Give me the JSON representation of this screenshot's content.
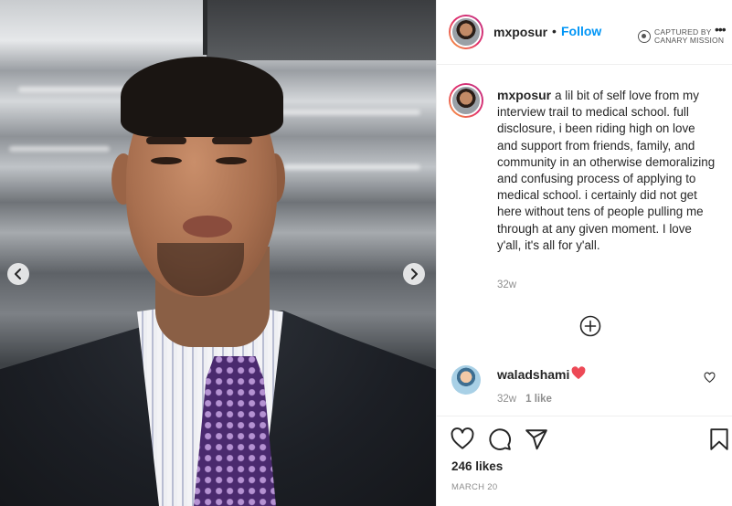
{
  "post": {
    "username": "mxposur",
    "separator": "•",
    "follow_label": "Follow",
    "watermark": {
      "line1": "CAPTURED BY",
      "line2": "CANARY MISSION"
    },
    "more_label": "•••",
    "caption": "a lil bit of self love from my interview trail to medical school. full disclosure, i been riding high on love and support from friends, family, and community in an otherwise demoralizing and confusing process of applying to medical school. i certainly did not get here without tens of people pulling me through at any given moment. I love y'all, it's all for y'all.",
    "caption_time": "32w",
    "likes": "246 likes",
    "date": "MARCH 20"
  },
  "comment": {
    "username": "waladshami",
    "time": "32w",
    "likes": "1 like",
    "heart_color": "#ed4956"
  },
  "icons": {
    "prev": "chevron-left-icon",
    "next": "chevron-right-icon",
    "add": "plus-circle-icon",
    "like": "heart-outline-icon",
    "comment": "comment-bubble-icon",
    "share": "paper-plane-icon",
    "save": "bookmark-icon"
  },
  "colors": {
    "link": "#0095f6",
    "text": "#262626",
    "muted": "#8e8e8e"
  }
}
